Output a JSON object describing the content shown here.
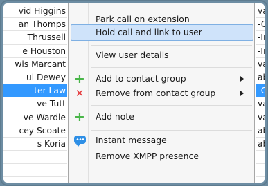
{
  "left_list": {
    "rows": [
      {
        "text": "vid Higgins",
        "selected": false
      },
      {
        "text": "an Thomps",
        "selected": false
      },
      {
        "text": "Thrussell",
        "selected": false
      },
      {
        "text": "e Houston",
        "selected": false
      },
      {
        "text": "wis Marcant",
        "selected": false
      },
      {
        "text": "ul Dewey",
        "selected": false
      },
      {
        "text": "ter Law",
        "selected": true
      },
      {
        "text": "ve Tutt",
        "selected": false
      },
      {
        "text": "ve Wardle",
        "selected": false
      },
      {
        "text": "cey Scoate",
        "selected": false
      },
      {
        "text": "s Koria",
        "selected": false
      },
      {
        "text": "",
        "selected": false
      },
      {
        "text": "",
        "selected": false
      }
    ]
  },
  "right_list": {
    "rows": [
      {
        "text": "vai",
        "selected": false
      },
      {
        "text": "-O",
        "selected": false
      },
      {
        "text": "-In",
        "selected": false
      },
      {
        "text": "-In",
        "selected": false
      },
      {
        "text": "vai",
        "selected": false
      },
      {
        "text": "ab",
        "selected": false
      },
      {
        "text": "-O",
        "selected": true
      },
      {
        "text": "vai",
        "selected": false
      },
      {
        "text": "vai",
        "selected": false
      },
      {
        "text": "ab",
        "selected": false
      },
      {
        "text": "ab",
        "selected": false
      },
      {
        "text": "",
        "selected": false
      },
      {
        "text": "",
        "selected": false
      }
    ]
  },
  "context_menu": {
    "items": {
      "park_call": {
        "label": "Park call on extension"
      },
      "hold_call": {
        "label": "Hold call and link to user"
      },
      "view_user": {
        "label": "View user details"
      },
      "add_group": {
        "label": "Add to contact group",
        "icon": "plus-icon"
      },
      "remove_group": {
        "label": "Remove from contact group",
        "icon": "cross-icon"
      },
      "add_note": {
        "label": "Add note",
        "icon": "plus-icon"
      },
      "instant_message": {
        "label": "Instant message",
        "icon": "chat-bubble-icon"
      },
      "remove_xmpp": {
        "label": "Remove XMPP presence"
      }
    }
  },
  "colors": {
    "selection": "#3399ff",
    "menu_highlight": "#cfe3fa",
    "add_icon": "#49b649",
    "remove_icon": "#e5383b",
    "im_icon": "#2e8fe6"
  }
}
